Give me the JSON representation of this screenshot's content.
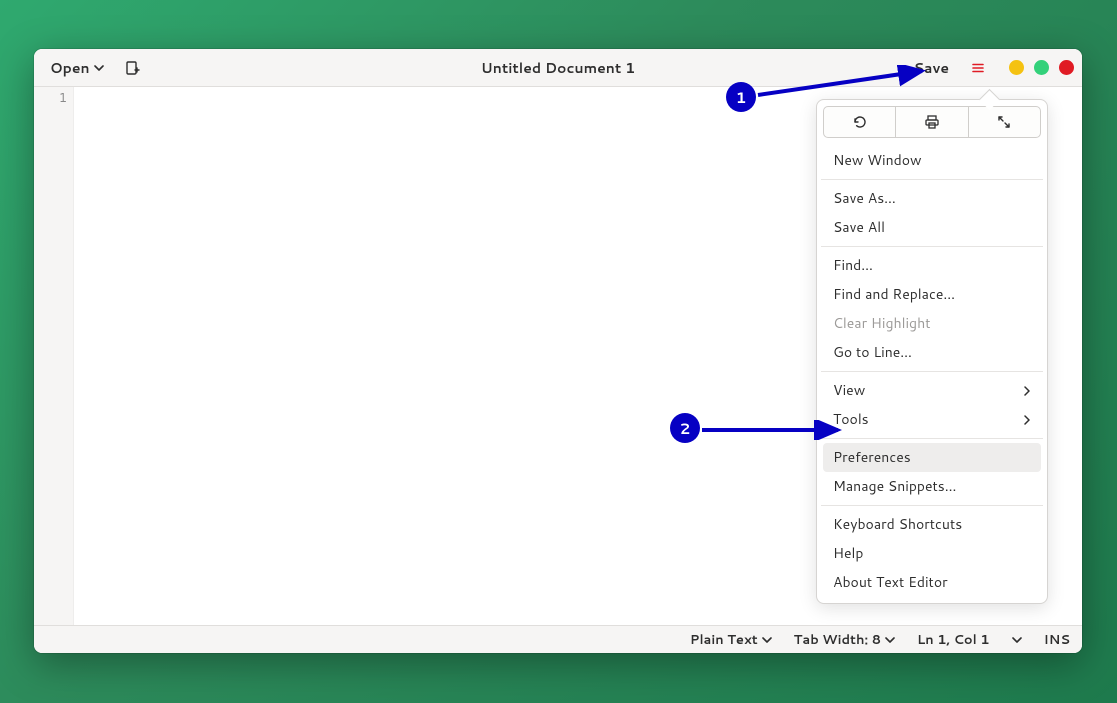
{
  "titlebar": {
    "open_label": "Open",
    "title": "Untitled Document 1",
    "save_label": "Save"
  },
  "gutter": {
    "line1": "1"
  },
  "statusbar": {
    "language": "Plain Text",
    "tab_width": "Tab Width: 8",
    "position": "Ln 1, Col 1",
    "insert_mode": "INS"
  },
  "menu": {
    "new_window": "New Window",
    "save_as": "Save As…",
    "save_all": "Save All",
    "find": "Find…",
    "find_replace": "Find and Replace…",
    "clear_highlight": "Clear Highlight",
    "goto_line": "Go to Line…",
    "view": "View",
    "tools": "Tools",
    "preferences": "Preferences",
    "manage_snippets": "Manage Snippets…",
    "keyboard_shortcuts": "Keyboard Shortcuts",
    "help": "Help",
    "about": "About Text Editor"
  },
  "annotations": {
    "step1": "1",
    "step2": "2"
  }
}
